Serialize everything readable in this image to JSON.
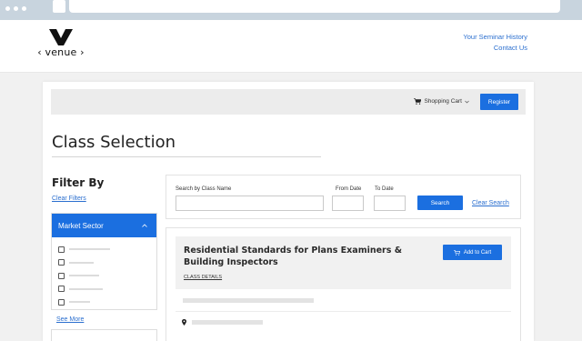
{
  "header": {
    "logo_text": "‹ venue ›",
    "links": [
      "Your Seminar History",
      "Contact Us"
    ]
  },
  "topbar": {
    "cart_label": "Shopping Cart",
    "register_label": "Register"
  },
  "page": {
    "title": "Class Selection"
  },
  "filters": {
    "title": "Filter By",
    "clear_label": "Clear Filters",
    "sector": {
      "label": "Market Sector",
      "items": [
        {
          "checked": false,
          "bar": 0.75
        },
        {
          "checked": false,
          "bar": 0.45
        },
        {
          "checked": false,
          "bar": 0.55
        },
        {
          "checked": false,
          "bar": 0.62
        },
        {
          "checked": false,
          "bar": 0.38
        }
      ]
    },
    "see_more_label": "See More"
  },
  "search": {
    "name_label": "Search by Class Name",
    "name_value": "",
    "from_label": "From Date",
    "from_value": "",
    "to_label": "To Date",
    "to_value": "",
    "search_label": "Search",
    "clear_label": "Clear Search"
  },
  "result": {
    "title": "Residential Standards for Plans Examiners & Building Inspectors",
    "details_label": "CLASS DETAILS",
    "add_label": "Add to Cart"
  },
  "colors": {
    "accent": "#1b6fe0",
    "link": "#2b6fcf"
  }
}
